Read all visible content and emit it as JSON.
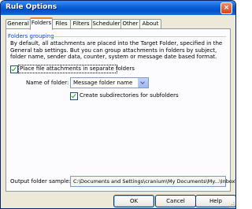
{
  "window": {
    "title": "Rule Options",
    "close_glyph": "×"
  },
  "tabs": [
    {
      "label": "General"
    },
    {
      "label": "Folders"
    },
    {
      "label": "Files"
    },
    {
      "label": "Filters"
    },
    {
      "label": "Scheduler"
    },
    {
      "label": "Other"
    },
    {
      "label": "About"
    }
  ],
  "active_tab": "Folders",
  "group": {
    "label": "Folders grouping",
    "description": "By default, all attachments are placed into the Target Folder, specified in the General tab settings. But you can group attachments in folders by subject, folder name, sender data, counter, system or message date based format."
  },
  "separate_folders": {
    "label": "Place file attachments in separate folders",
    "checked": true
  },
  "name_of_folder": {
    "label": "Name of folder:",
    "value": "Message folder name"
  },
  "subdirectories": {
    "label": "Create subdirectories for subfolders",
    "checked": true
  },
  "output_sample": {
    "label": "Output folder sample:",
    "value": "C:\\Documents and Settings\\cranium\\My Documents\\My...\\Inbox\\"
  },
  "buttons": {
    "ok": "OK",
    "cancel": "Cancel",
    "help": "Help"
  }
}
